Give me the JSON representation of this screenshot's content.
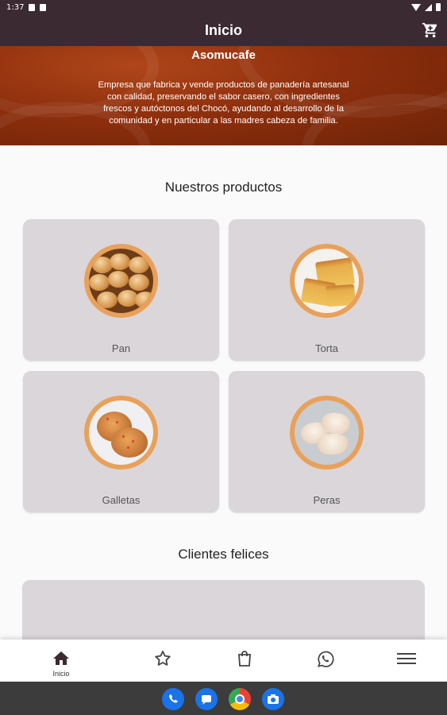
{
  "status_bar": {
    "time": "1:37"
  },
  "app_bar": {
    "title": "Inicio"
  },
  "hero": {
    "title": "Asomucafe",
    "description": "Empresa que fabrica y vende productos de panadería artesanal con calidad, preservando el sabor casero, con ingredientes frescos y autóctonos del Chocó, ayudando al desarrollo de la comunidad y en particular a las madres cabeza de familia."
  },
  "products_section": {
    "title": "Nuestros productos",
    "items": [
      {
        "label": "Pan"
      },
      {
        "label": "Torta"
      },
      {
        "label": "Galletas"
      },
      {
        "label": "Peras"
      }
    ]
  },
  "testimonials_section": {
    "title": "Clientes felices"
  },
  "bottom_nav": {
    "items": [
      {
        "label": "Inicio",
        "icon": "home-icon",
        "active": true
      },
      {
        "label": "",
        "icon": "star-icon"
      },
      {
        "label": "",
        "icon": "shopping-bag-icon"
      },
      {
        "label": "",
        "icon": "whatsapp-icon"
      },
      {
        "label": "",
        "icon": "menu-icon"
      }
    ]
  },
  "dock": {
    "apps": [
      "phone-icon",
      "messages-icon",
      "chrome-icon",
      "camera-icon"
    ]
  },
  "colors": {
    "primary": "#3b2a31",
    "hero": "#8e2f0d",
    "card": "#dad6da",
    "ring": "#e8a15a"
  }
}
